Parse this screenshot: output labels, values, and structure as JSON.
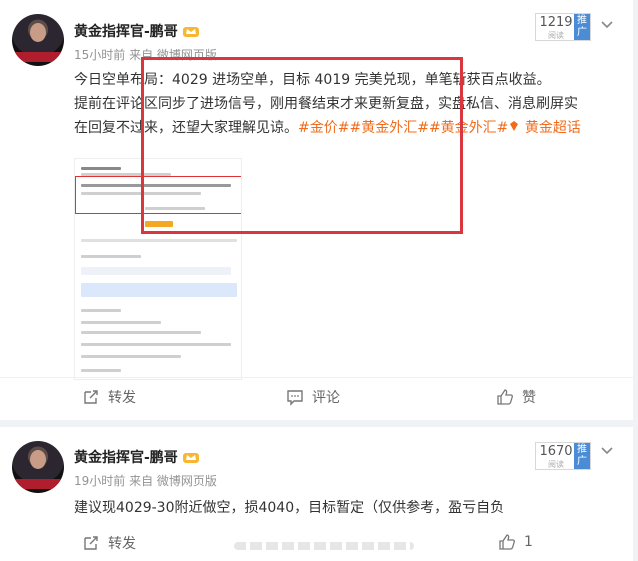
{
  "posts": [
    {
      "username": "黄金指挥官-鹏哥",
      "time": "15小时前",
      "source": "来自 微博网页版",
      "reads": "1219",
      "reads_label": "阅读",
      "push_label": "推广",
      "text_line1": "今日空单布局：4029 进场空单，目标 4019 完美兑现，单笔斩获百点收益。",
      "text_line2": "提前在评论区同步了进场信号，刚用餐结束才来更新复盘，实盘私信、消息刷屏实",
      "text_line3": "在回复不过来，还望大家理解见谅。",
      "topic1": "#金价#",
      "topic2": "#黄金外汇#",
      "topic3": "#黄金外汇#",
      "topic4": " 黄金超话",
      "actions": {
        "repost": "转发",
        "comment": "评论",
        "like": "赞"
      }
    },
    {
      "username": "黄金指挥官-鹏哥",
      "time": "19小时前",
      "source": "来自 微博网页版",
      "reads": "1670",
      "reads_label": "阅读",
      "push_label": "推广",
      "text": "建议现4029-30附近做空，损4040，目标暂定（仅供参考，盈亏自负",
      "actions": {
        "repost": "转发",
        "like_count": "1"
      }
    }
  ],
  "colors": {
    "topic": "#f06c1c",
    "highlight_box": "#d9363e",
    "push_badge": "#4a8dd6"
  }
}
